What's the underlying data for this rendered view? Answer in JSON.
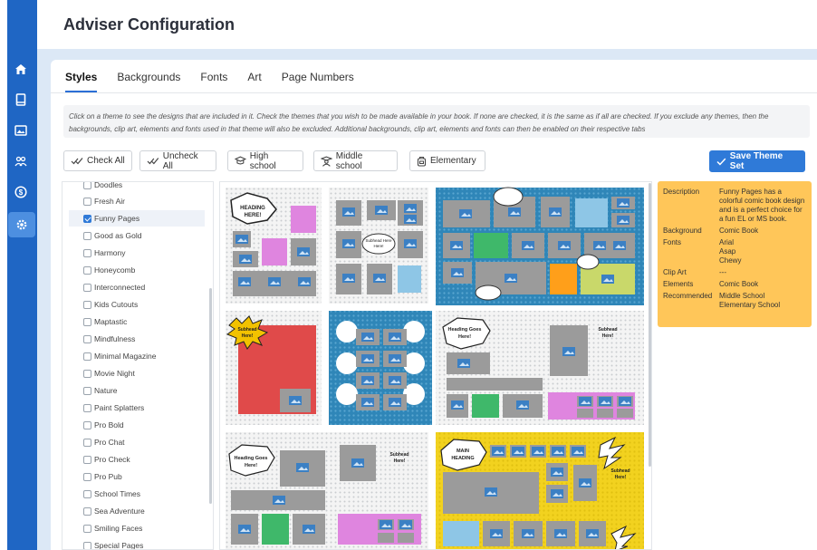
{
  "app": {
    "title": "Adviser Configuration"
  },
  "nav": [
    {
      "name": "home-icon",
      "active": false
    },
    {
      "name": "book-icon",
      "active": false
    },
    {
      "name": "image-icon",
      "active": false
    },
    {
      "name": "users-icon",
      "active": false
    },
    {
      "name": "dollar-icon",
      "active": false
    },
    {
      "name": "gear-icon",
      "active": true
    }
  ],
  "tabs": [
    "Styles",
    "Backgrounds",
    "Fonts",
    "Art",
    "Page Numbers"
  ],
  "active_tab": "Styles",
  "info_text": "Click on a theme to see the designs that are included in it. Check the themes that you wish to be made available in your book. If none are checked, it is the same as if all are checked. If you exclude any themes, then the backgrounds, clip art, elements and fonts used in that theme will also be excluded. Additional backgrounds, clip art, elements and fonts can then be enabled on their respective tabs",
  "toolbar": {
    "check_all": "Check All",
    "uncheck_all": "Uncheck All",
    "high_school": "High school",
    "middle_school": "Middle school",
    "elementary": "Elementary",
    "save": "Save Theme Set"
  },
  "themes": [
    {
      "name": "Doodles",
      "checked": false
    },
    {
      "name": "Fresh Air",
      "checked": false
    },
    {
      "name": "Funny Pages",
      "checked": true
    },
    {
      "name": "Good as Gold",
      "checked": false
    },
    {
      "name": "Harmony",
      "checked": false
    },
    {
      "name": "Honeycomb",
      "checked": false
    },
    {
      "name": "Interconnected",
      "checked": false
    },
    {
      "name": "Kids Cutouts",
      "checked": false
    },
    {
      "name": "Maptastic",
      "checked": false
    },
    {
      "name": "Mindfulness",
      "checked": false
    },
    {
      "name": "Minimal Magazine",
      "checked": false
    },
    {
      "name": "Movie Night",
      "checked": false
    },
    {
      "name": "Nature",
      "checked": false
    },
    {
      "name": "Paint Splatters",
      "checked": false
    },
    {
      "name": "Pro Bold",
      "checked": false
    },
    {
      "name": "Pro Chat",
      "checked": false
    },
    {
      "name": "Pro Check",
      "checked": false
    },
    {
      "name": "Pro Pub",
      "checked": false
    },
    {
      "name": "School Times",
      "checked": false
    },
    {
      "name": "Sea Adventure",
      "checked": false
    },
    {
      "name": "Smiling Faces",
      "checked": false
    },
    {
      "name": "Special Pages",
      "checked": false
    }
  ],
  "preview_texts": {
    "heading_here": "HEADING HERE!",
    "subhead_here": "Subhead Here!",
    "heading_goes_here": "Heading Goes Here!",
    "main_heading": "MAIN HEADING"
  },
  "detail": {
    "description_label": "Description",
    "description": "Funny Pages has a colorful comic book design and is a perfect choice for a fun EL or MS book.",
    "background_label": "Background",
    "background": "Comic Book",
    "fonts_label": "Fonts",
    "fonts": [
      "Arial",
      "Asap",
      "Chewy"
    ],
    "clipart_label": "Clip Art",
    "clipart": "---",
    "elements_label": "Elements",
    "elements": "Comic Book",
    "recommended_label": "Recommended",
    "recommended": [
      "Middle School",
      "Elementary School"
    ]
  },
  "colors": {
    "sidebar": "#1f66c4",
    "accent": "#2f7ad8",
    "detail_bg": "#ffc659",
    "comic_gray": "#a9a9a9",
    "comic_blue": "#2f86b8",
    "comic_yellow": "#f2d21f",
    "comic_red": "#e04a4a"
  }
}
